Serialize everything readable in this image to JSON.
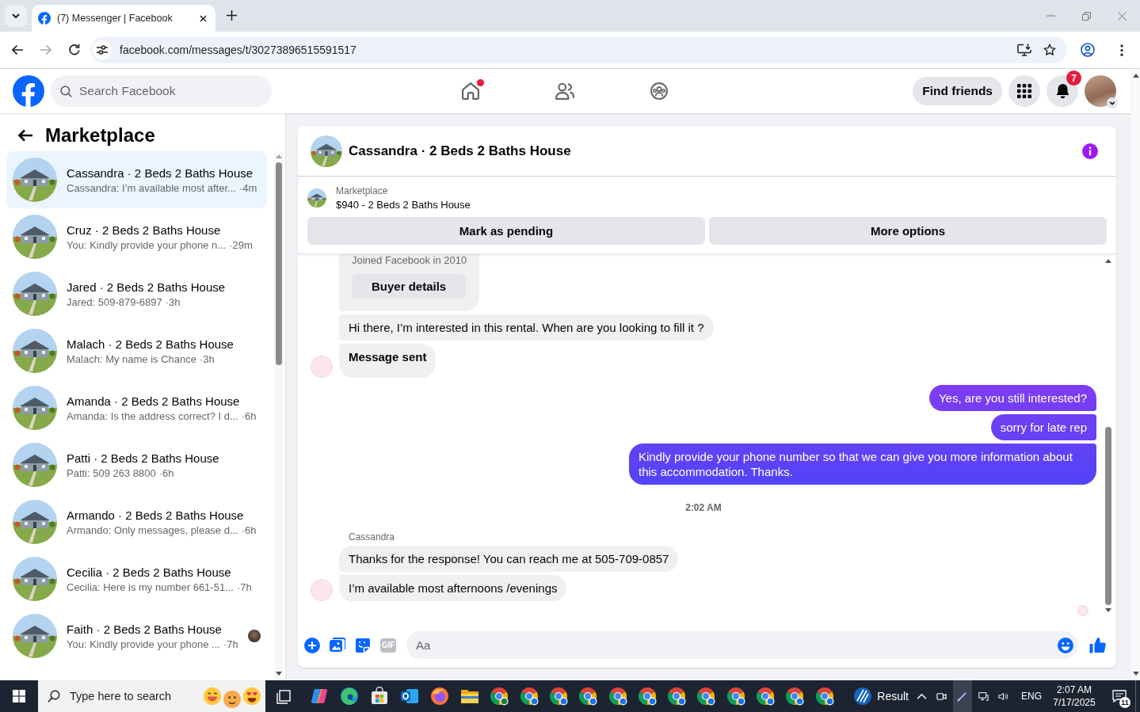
{
  "browser": {
    "tab": {
      "title": "(7) Messenger | Facebook",
      "selected": true
    },
    "nav": [
      {
        "kind": "back",
        "disabled": false
      },
      {
        "kind": "forward",
        "disabled": true
      },
      {
        "kind": "reload",
        "disabled": false
      }
    ],
    "url": "facebook.com/messages/t/30273896515591517"
  },
  "header": {
    "search": {
      "placeholder": "Search Facebook"
    },
    "nav": [
      {
        "kind": "home",
        "selected": false,
        "dot": true
      },
      {
        "kind": "friends",
        "selected": false,
        "dot": false
      },
      {
        "kind": "groups",
        "selected": false,
        "dot": false
      }
    ],
    "find_friends": "Find friends",
    "notifications": "7"
  },
  "sidebar": {
    "title": "Marketplace",
    "conversations": [
      {
        "title": "Cassandra · 2 Beds 2 Baths House",
        "preview": "Cassandra: I’m available most after...",
        "time": "·4m",
        "selected": true,
        "seen": false
      },
      {
        "title": "Cruz · 2 Beds 2 Baths House",
        "preview": "You: Kindly provide your phone n...",
        "time": "·29m",
        "selected": false,
        "seen": false
      },
      {
        "title": "Jared · 2 Beds 2 Baths House",
        "preview": "Jared: 509-879-6897",
        "time": "·3h",
        "selected": false,
        "seen": false
      },
      {
        "title": "Malach · 2 Beds 2 Baths House",
        "preview": "Malach: My name is Chance",
        "time": "·3h",
        "selected": false,
        "seen": false
      },
      {
        "title": "Amanda · 2 Beds 2 Baths House",
        "preview": "Amanda: Is the address correct? I d...",
        "time": "·6h",
        "selected": false,
        "seen": false
      },
      {
        "title": "Patti · 2 Beds 2 Baths House",
        "preview": "Patti: 509 263 8800",
        "time": "·6h",
        "selected": false,
        "seen": false
      },
      {
        "title": "Armando · 2 Beds 2 Baths House",
        "preview": "Armando: Only messages, please d...",
        "time": "·6h",
        "selected": false,
        "seen": false
      },
      {
        "title": "Cecilia · 2 Beds 2 Baths House",
        "preview": "Cecilia: Here is my number 661-51...",
        "time": "·7h",
        "selected": false,
        "seen": false
      },
      {
        "title": "Faith · 2 Beds 2 Baths House",
        "preview": "You: Kindly provide your phone ...",
        "time": "·7h",
        "selected": false,
        "seen": true
      }
    ]
  },
  "chat": {
    "title": "Cassandra · 2 Beds 2 Baths House",
    "listing": {
      "label": "Marketplace",
      "title": "$940 - 2 Beds 2 Baths House"
    },
    "actions": [
      "Mark as pending",
      "More options"
    ],
    "messages": [
      {
        "kind": "card",
        "text": "Joined Facebook in 2010",
        "button": "Buyer details"
      },
      {
        "kind": "incoming",
        "text": "Hi there, I’m interested in this rental. When are you looking to fill it ?",
        "avatar": false,
        "bold": false
      },
      {
        "kind": "incoming",
        "text": "Message sent",
        "avatar": true,
        "bold": true
      },
      {
        "kind": "outgoing",
        "text": "Yes, are you still interested?"
      },
      {
        "kind": "outgoing",
        "text": "sorry for late rep"
      },
      {
        "kind": "outgoing",
        "text": "Kindly provide your phone number so that we can give you more information about this accommodation. Thanks."
      },
      {
        "kind": "timestamp",
        "text": "2:02 AM"
      },
      {
        "kind": "sender",
        "text": "Cassandra"
      },
      {
        "kind": "incoming",
        "text": "Thanks for the response! You can reach me at 505-709-0857",
        "avatar": false,
        "bold": false
      },
      {
        "kind": "incoming",
        "text": "I’m available most afternoons /evenings",
        "avatar": true,
        "bold": false
      }
    ],
    "seen": true,
    "composer": {
      "gif": "GIF",
      "placeholder": "Aa"
    }
  },
  "taskbar": {
    "search": {
      "placeholder": "Type here to search"
    },
    "widget": "Result",
    "language": "ENG",
    "time": "2:07 AM",
    "date": "7/17/2025",
    "notifications": "11"
  }
}
